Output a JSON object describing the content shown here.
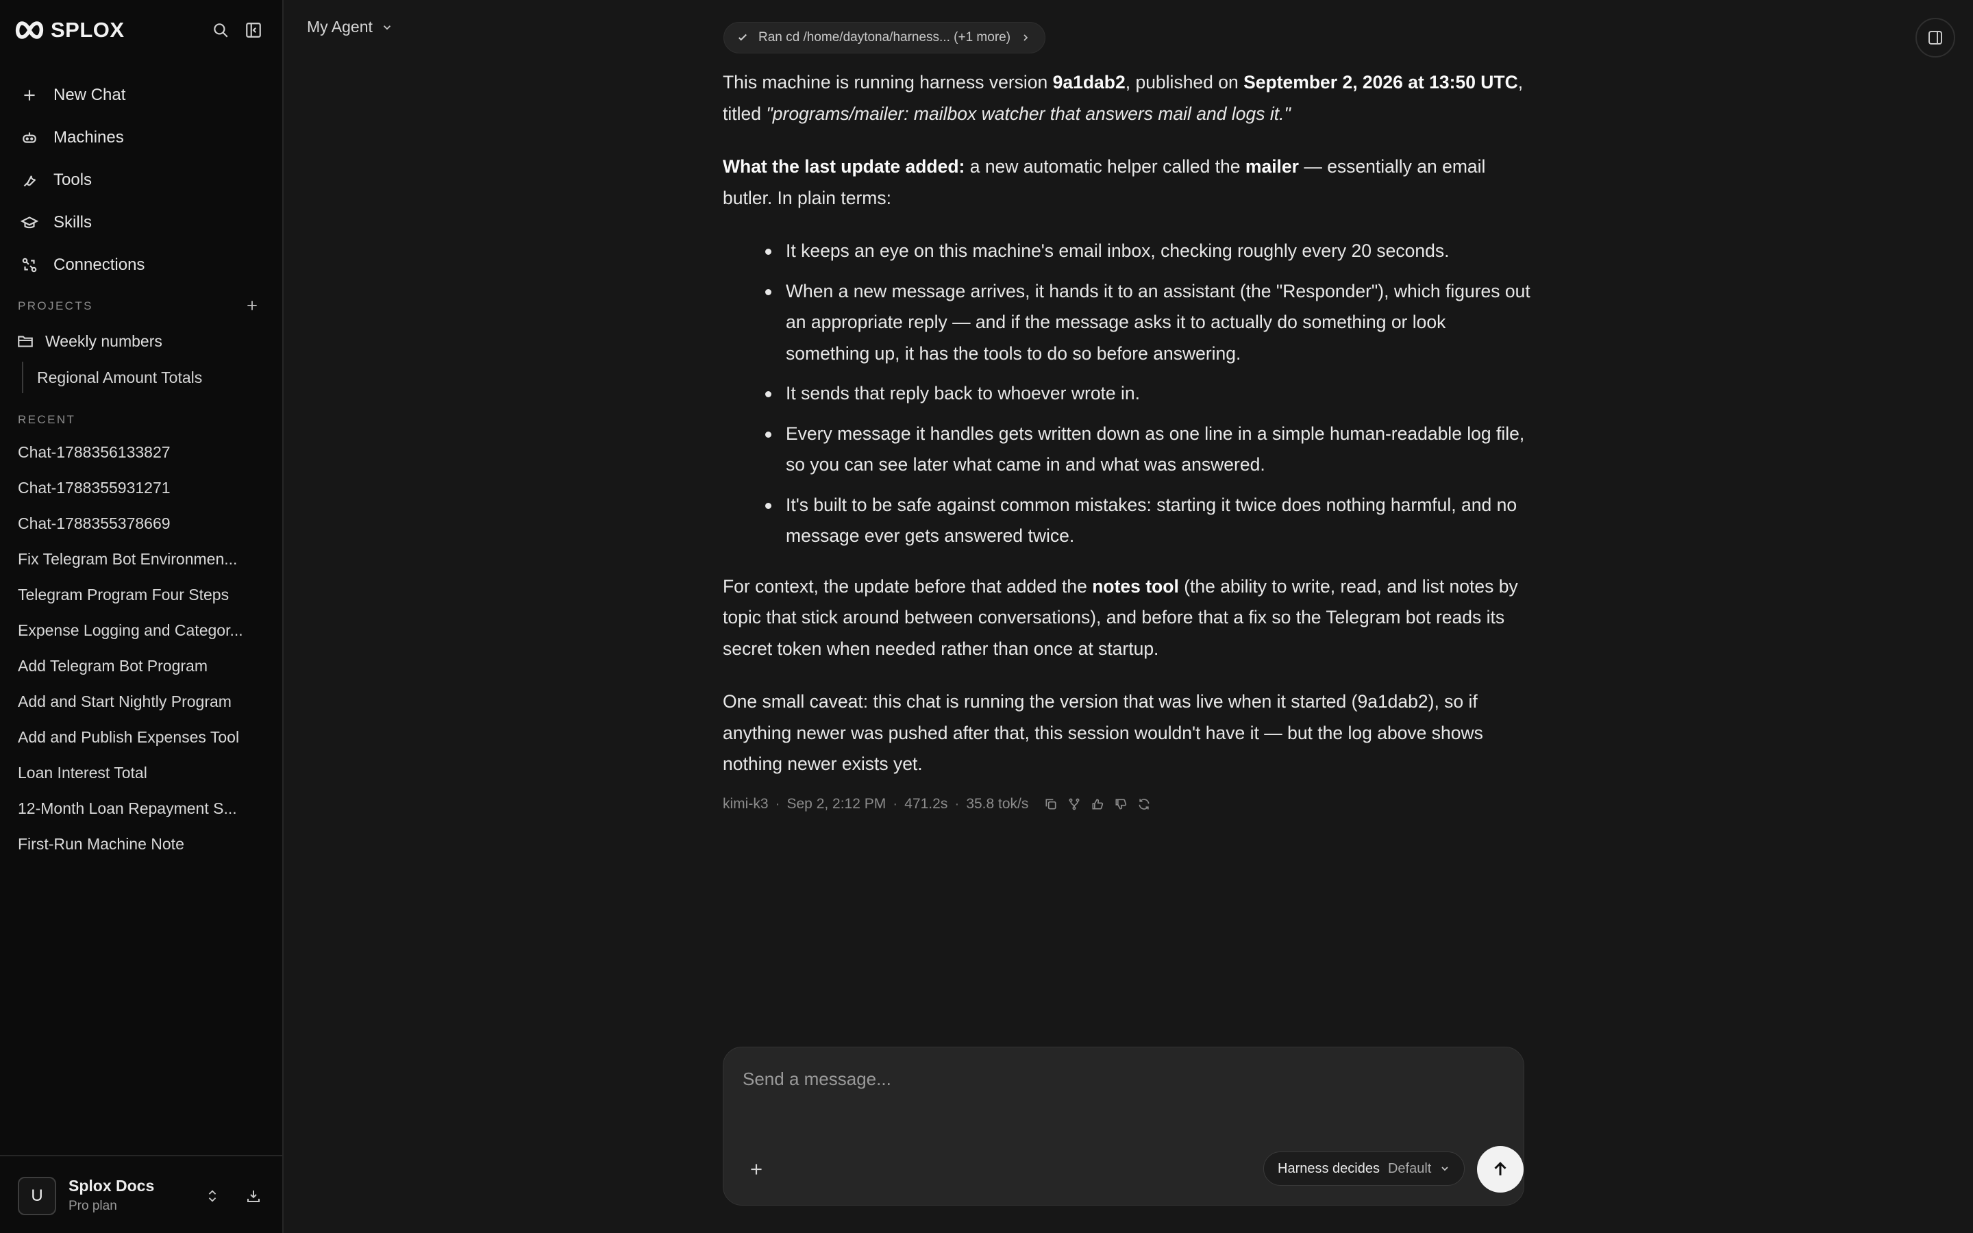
{
  "sidebar": {
    "brand": "SPLOX",
    "nav": [
      {
        "label": "New Chat",
        "icon": "plus-icon"
      },
      {
        "label": "Machines",
        "icon": "robot-icon"
      },
      {
        "label": "Tools",
        "icon": "wrench-icon"
      },
      {
        "label": "Skills",
        "icon": "graduation-cap-icon"
      },
      {
        "label": "Connections",
        "icon": "connections-icon"
      }
    ],
    "projects_label": "PROJECTS",
    "project": {
      "label": "Weekly numbers",
      "child": "Regional Amount Totals"
    },
    "recent_label": "RECENT",
    "recent": [
      "Chat-1788356133827",
      "Chat-1788355931271",
      "Chat-1788355378669",
      "Fix Telegram Bot Environmen...",
      "Telegram Program Four Steps",
      "Expense Logging and Categor...",
      "Add Telegram Bot Program",
      "Add and Start Nightly Program",
      "Add and Publish Expenses Tool",
      "Loan Interest Total",
      "12-Month Loan Repayment S...",
      "First-Run Machine Note"
    ],
    "account": {
      "initial": "U",
      "name": "Splox Docs",
      "plan": "Pro plan"
    }
  },
  "header": {
    "agent": "My Agent"
  },
  "tool_chip": "Ran cd /home/daytona/harness... (+1 more)",
  "message": {
    "p1": {
      "t1": "This machine is running harness version ",
      "version": "9a1dab2",
      "t2": ", published on ",
      "date": "September 2, 2026 at 13:50 UTC",
      "t3": ", titled ",
      "title": "\"programs/mailer: mailbox watcher that answers mail and logs it.\""
    },
    "p2": {
      "lead": "What the last update added:",
      "t1": " a new automatic helper called the ",
      "mailer": "mailer",
      "t2": " — essentially an email butler. In plain terms:"
    },
    "bullets": [
      "It keeps an eye on this machine's email inbox, checking roughly every 20 seconds.",
      "When a new message arrives, it hands it to an assistant (the \"Responder\"), which figures out an appropriate reply — and if the message asks it to actually do something or look something up, it has the tools to do so before answering.",
      "It sends that reply back to whoever wrote in.",
      "Every message it handles gets written down as one line in a simple human-readable log file, so you can see later what came in and what was answered.",
      "It's built to be safe against common mistakes: starting it twice does nothing harmful, and no message ever gets answered twice."
    ],
    "p3": {
      "t1": "For context, the update before that added the ",
      "notes": "notes tool",
      "t2": " (the ability to write, read, and list notes by topic that stick around between conversations), and before that a fix so the Telegram bot reads its secret token when needed rather than once at startup."
    },
    "p4": "One small caveat: this chat is running the version that was live when it started (9a1dab2), so if anything newer was pushed after that, this session wouldn't have it — but the log above shows nothing newer exists yet."
  },
  "meta": {
    "model": "kimi-k3",
    "time": "Sep 2, 2:12 PM",
    "duration": "471.2s",
    "speed": "35.8 tok/s",
    "sep": "·"
  },
  "composer": {
    "placeholder": "Send a message...",
    "mode": "Harness decides",
    "mode_value": "Default"
  }
}
